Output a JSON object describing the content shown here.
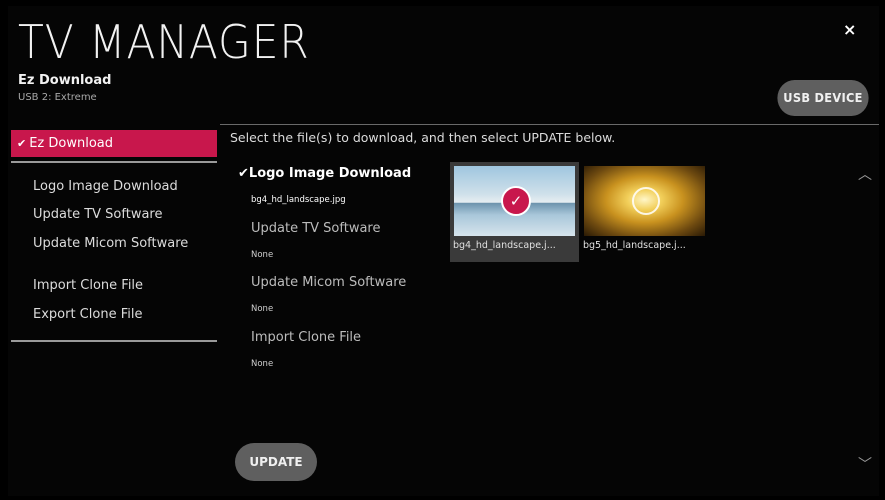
{
  "header": {
    "app_title": "TV MANAGER",
    "subtitle": "Ez Download",
    "source": "USB 2: Extreme",
    "close_icon": "×",
    "usb_button": "USB DEVICE"
  },
  "sidebar": {
    "active_item": {
      "check": "✔",
      "label": "Ez Download"
    },
    "items": [
      {
        "label": "Logo Image Download"
      },
      {
        "label": "Update TV Software"
      },
      {
        "label": "Update Micom Software"
      },
      {
        "label": "Import Clone File"
      },
      {
        "label": "Export Clone File"
      }
    ]
  },
  "main": {
    "instruction": "Select the file(s) to download, and then select UPDATE below.",
    "sections": [
      {
        "check": "✔",
        "title": "Logo Image Download",
        "value": "bg4_hd_landscape.jpg",
        "selected": true
      },
      {
        "title": "Update TV Software",
        "value": "None"
      },
      {
        "title": "Update Micom Software",
        "value": "None"
      },
      {
        "title": "Import Clone File",
        "value": "None"
      }
    ],
    "files": [
      {
        "caption": "bg4_hd_landscape.j...",
        "selected": true,
        "check": "✓"
      },
      {
        "caption": "bg5_hd_landscape.j...",
        "selected": false
      }
    ],
    "update_button": "UPDATE",
    "scroll_up": "︿",
    "scroll_down": "﹀"
  },
  "colors": {
    "accent": "#c8174c",
    "button": "#5f5f5f",
    "background": "#000000"
  }
}
